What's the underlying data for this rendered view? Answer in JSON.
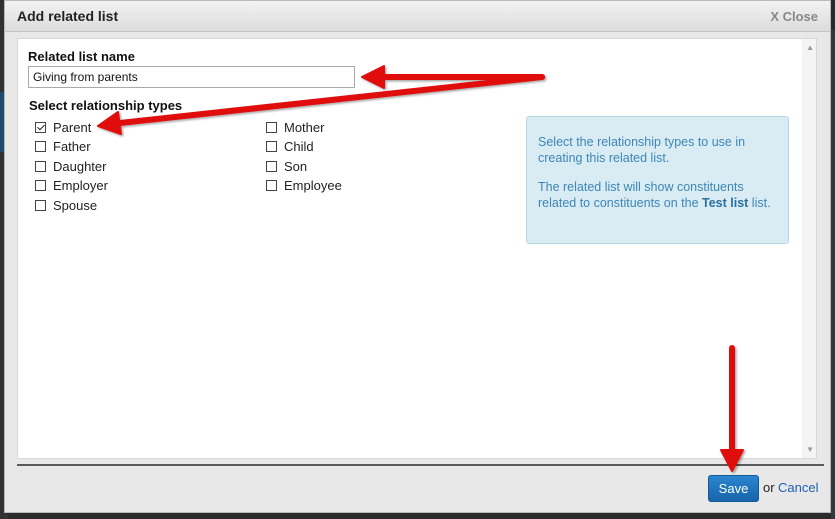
{
  "dialog": {
    "title": "Add related list",
    "close_label": "X Close"
  },
  "form": {
    "name_label": "Related list name",
    "name_value": "Giving from parents",
    "types_label": "Select relationship types",
    "types_col1": [
      {
        "label": "Parent",
        "checked": true
      },
      {
        "label": "Father",
        "checked": false
      },
      {
        "label": "Daughter",
        "checked": false
      },
      {
        "label": "Employer",
        "checked": false
      },
      {
        "label": "Spouse",
        "checked": false
      }
    ],
    "types_col2": [
      {
        "label": "Mother",
        "checked": false
      },
      {
        "label": "Child",
        "checked": false
      },
      {
        "label": "Son",
        "checked": false
      },
      {
        "label": "Employee",
        "checked": false
      }
    ]
  },
  "info": {
    "line1": "Select the relationship types to use in creating this related list.",
    "line2_prefix": "The related list will show constituents related to constituents on the ",
    "line2_bold": "Test list",
    "line2_suffix": " list."
  },
  "footer": {
    "save_label": "Save",
    "or_text": "or",
    "cancel_label": "Cancel"
  },
  "colors": {
    "accent": "#1f6fbd",
    "annotation_arrow": "#e01010",
    "info_bg": "#d9ecf4"
  }
}
